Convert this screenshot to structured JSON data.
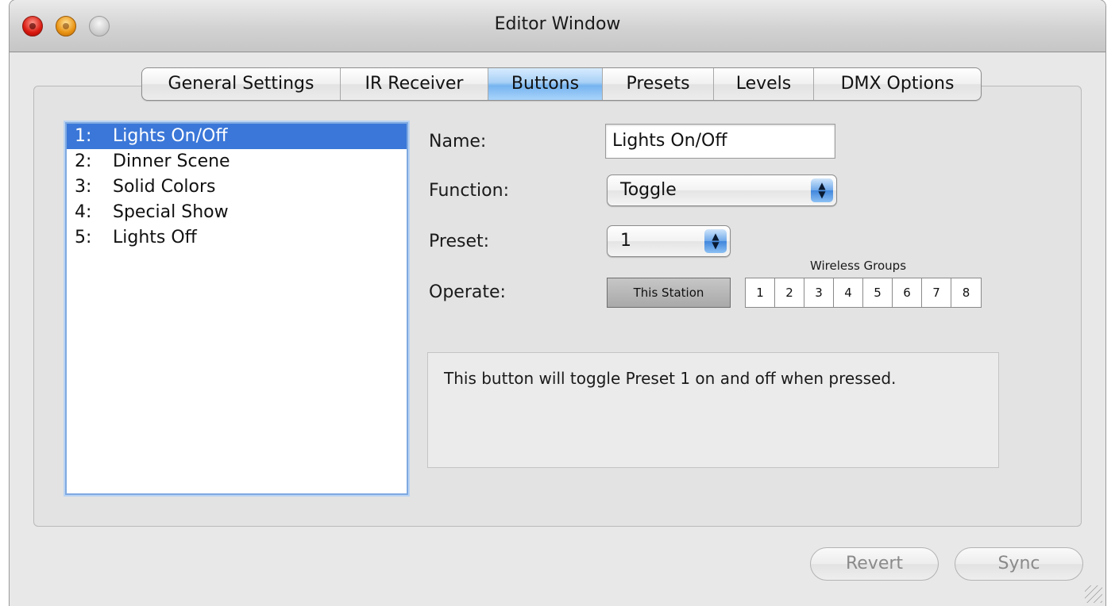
{
  "window": {
    "title": "Editor Window"
  },
  "tabs": [
    {
      "label": "General Settings",
      "active": false
    },
    {
      "label": "IR Receiver",
      "active": false
    },
    {
      "label": "Buttons",
      "active": true
    },
    {
      "label": "Presets",
      "active": false
    },
    {
      "label": "Levels",
      "active": false
    },
    {
      "label": "DMX Options",
      "active": false
    }
  ],
  "button_list": [
    {
      "num": "1:",
      "name": "Lights On/Off",
      "selected": true
    },
    {
      "num": "2:",
      "name": "Dinner Scene",
      "selected": false
    },
    {
      "num": "3:",
      "name": "Solid Colors",
      "selected": false
    },
    {
      "num": "4:",
      "name": "Special Show",
      "selected": false
    },
    {
      "num": "5:",
      "name": "Lights Off",
      "selected": false
    }
  ],
  "form": {
    "name_label": "Name:",
    "name_value": "Lights On/Off",
    "function_label": "Function:",
    "function_value": "Toggle",
    "preset_label": "Preset:",
    "preset_value": "1",
    "operate_label": "Operate:",
    "this_station_label": "This Station",
    "wireless_groups_label": "Wireless Groups",
    "wireless_groups": [
      "1",
      "2",
      "3",
      "4",
      "5",
      "6",
      "7",
      "8"
    ],
    "description": "This button will toggle Preset 1 on and off when pressed."
  },
  "footer": {
    "revert_label": "Revert",
    "sync_label": "Sync"
  },
  "colors": {
    "selection": "#3b77d8",
    "active_tab": "#76b3ef"
  }
}
